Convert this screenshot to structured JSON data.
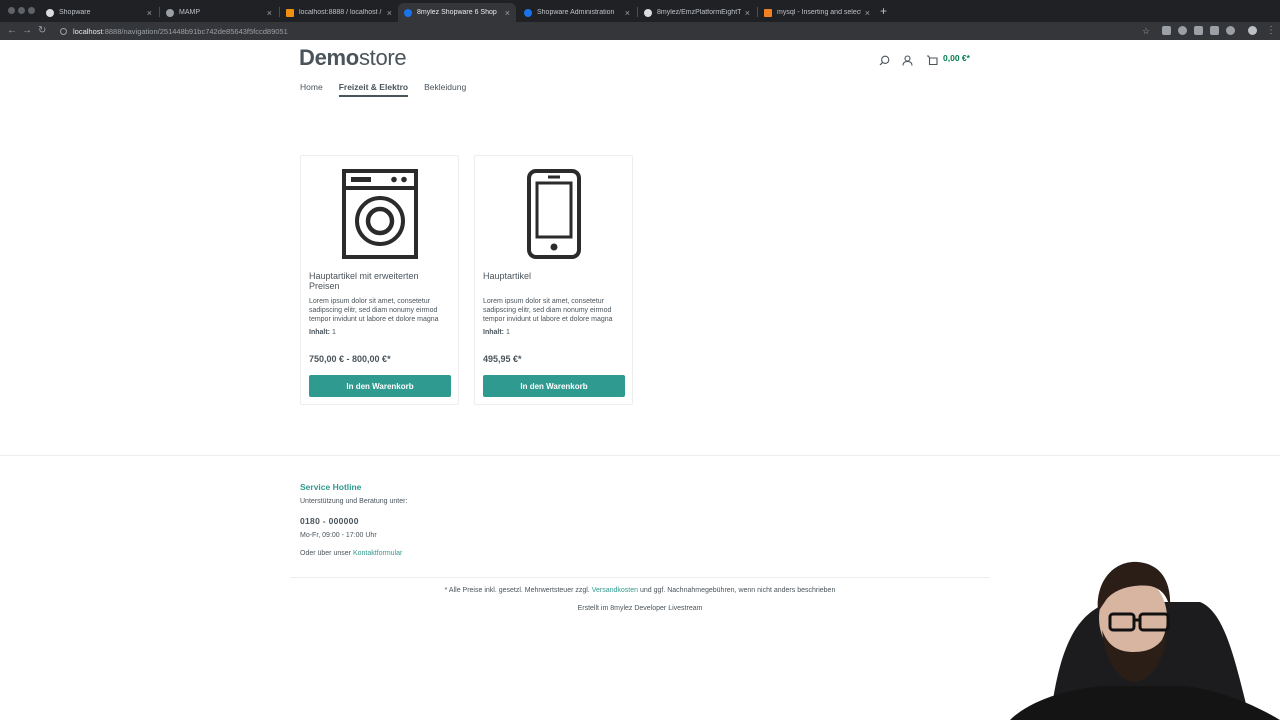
{
  "browser": {
    "tabs": [
      {
        "title": "Shopware",
        "active": false
      },
      {
        "title": "MAMP",
        "active": false
      },
      {
        "title": "localhost:8888 / localhost / sh",
        "active": false
      },
      {
        "title": "8mylez Shopware 6 Shop",
        "active": true
      },
      {
        "title": "Shopware Administration",
        "active": false
      },
      {
        "title": "8mylez/EmzPlatformEightTheme",
        "active": false
      },
      {
        "title": "mysql - Inserting and selecting",
        "active": false
      }
    ],
    "url_host": "localhost",
    "url_path": ":8888/navigation/251448b91bc742de85643f5fccd89051"
  },
  "header": {
    "logo_bold": "Demo",
    "logo_light": "store",
    "cart_total": "0,00 €*"
  },
  "nav": {
    "items": [
      {
        "label": "Home"
      },
      {
        "label": "Freizeit & Elektro"
      },
      {
        "label": "Bekleidung"
      }
    ]
  },
  "products": [
    {
      "name": "Hauptartikel mit erweiterten Preisen",
      "description": "Lorem ipsum dolor sit amet, consetetur sadipscing elitr, sed diam nonumy eirmod tempor invidunt ut labore et dolore magna",
      "unit_label": "Inhalt:",
      "unit_value": "1",
      "price": "750,00 € - 800,00 €*",
      "button": "In den Warenkorb",
      "icon": "washing-machine-icon"
    },
    {
      "name": "Hauptartikel",
      "description": "Lorem ipsum dolor sit amet, consetetur sadipscing elitr, sed diam nonumy eirmod tempor invidunt ut labore et dolore magna",
      "unit_label": "Inhalt:",
      "unit_value": "1",
      "price": "495,95 €*",
      "button": "In den Warenkorb",
      "icon": "smartphone-icon"
    }
  ],
  "footer": {
    "hotline_title": "Service Hotline",
    "support_text": "Unterstützung und Beratung unter:",
    "phone": "0180 - 000000",
    "hours": "Mo-Fr, 09:00 - 17:00 Uhr",
    "contact_prefix": "Oder über unser",
    "contact_link": "Kontaktformular",
    "vat_prefix": "* Alle Preise inkl. gesetzl. Mehrwertsteuer zzgl.",
    "vat_link": "Versandkosten",
    "vat_suffix": "und ggf. Nachnahmegebühren, wenn nicht anders beschrieben",
    "credit": "Erstellt im 8mylez Developer Livestream"
  },
  "colors": {
    "accent": "#2f9a8f",
    "text": "#4a545b",
    "cart_green": "#007e4e"
  }
}
